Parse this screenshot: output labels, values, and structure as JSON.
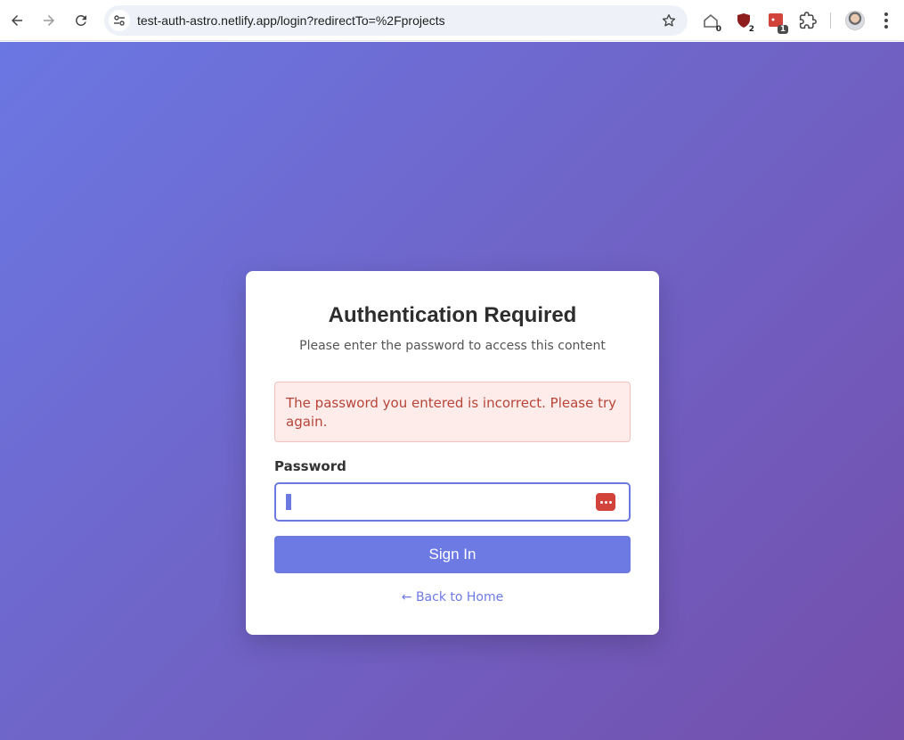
{
  "browser": {
    "url": "test-auth-astro.netlify.app/login?redirectTo=%2Fprojects",
    "extensions": [
      {
        "name": "home-extension-icon",
        "badge": "0"
      },
      {
        "name": "shield-extension-icon",
        "badge": "2"
      },
      {
        "name": "red-extension-icon",
        "badge": "1"
      }
    ]
  },
  "login": {
    "title": "Authentication Required",
    "subtitle": "Please enter the password to access this content",
    "error": "The password you entered is incorrect. Please try again.",
    "password_label": "Password",
    "password_value": "",
    "submit_label": "Sign In",
    "back_link": "← Back to Home"
  },
  "colors": {
    "accent": "#6d7ae4",
    "error_text": "#b7453a",
    "error_bg": "#fdecea",
    "background_start": "#6b77e3",
    "background_end": "#744fac"
  }
}
